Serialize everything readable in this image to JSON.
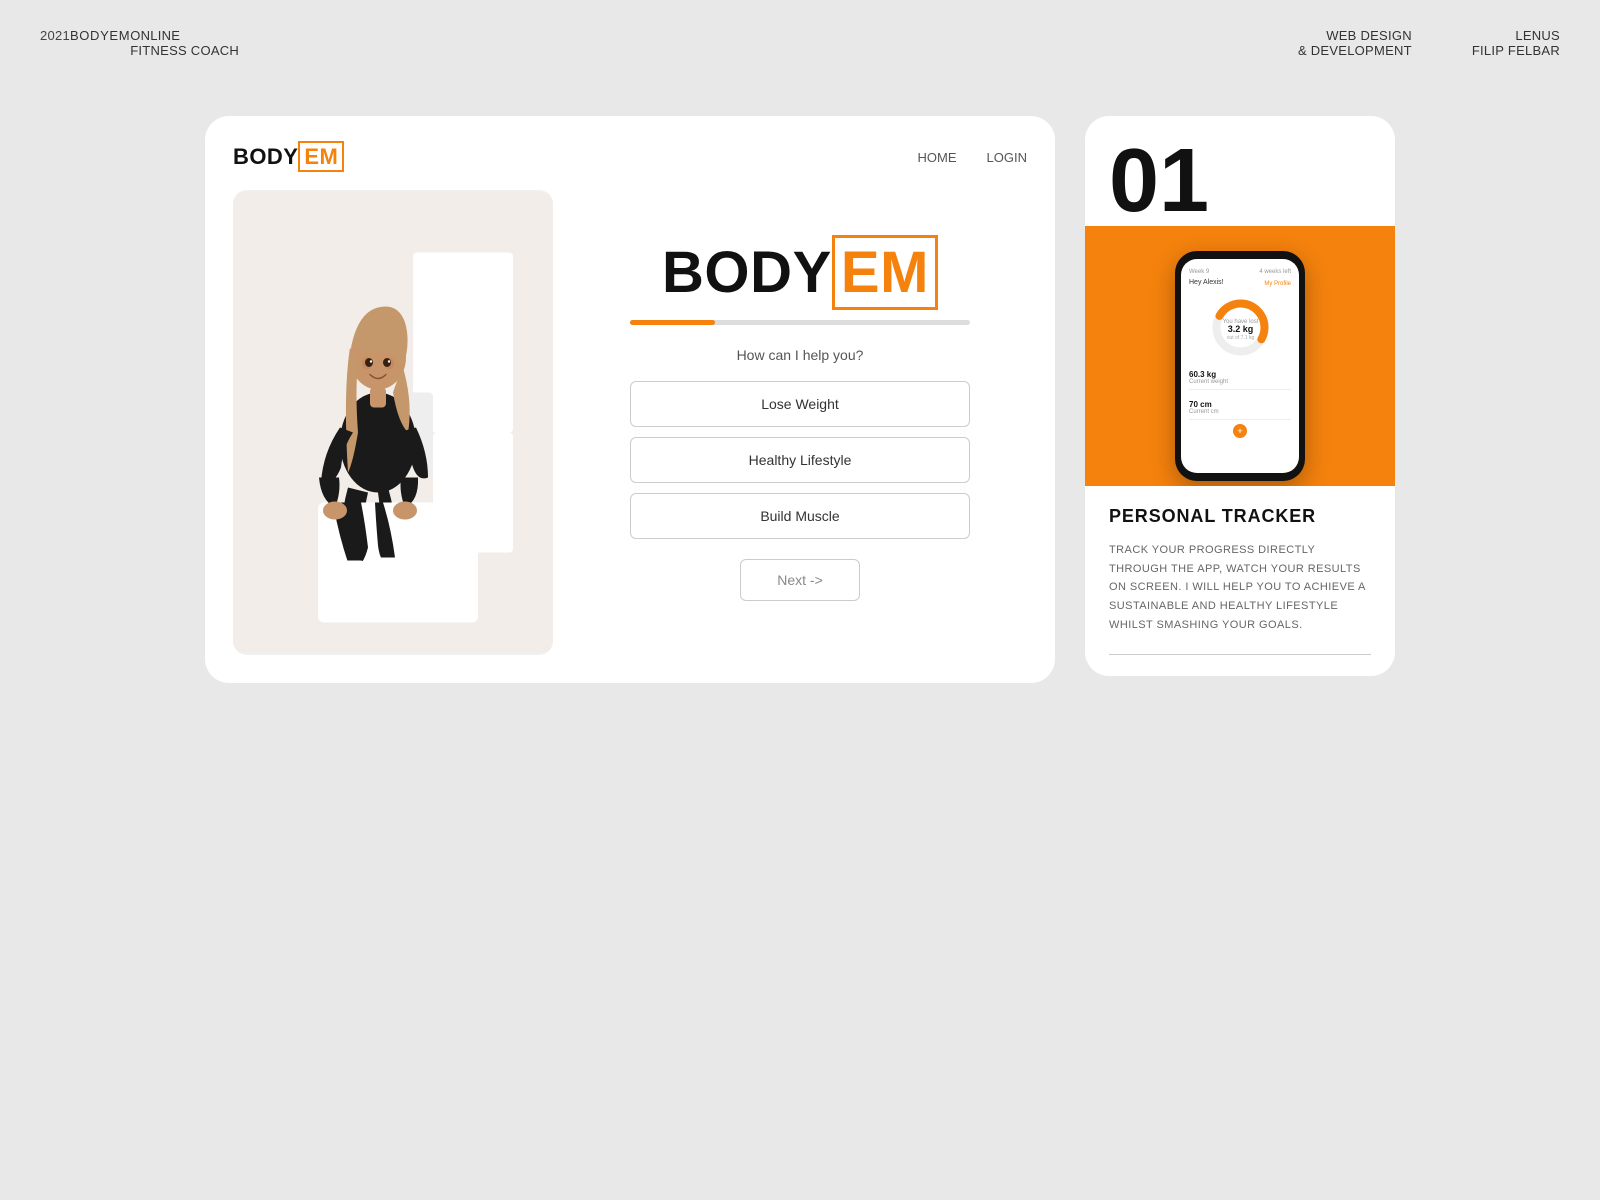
{
  "topnav": {
    "year": "2021",
    "brand": "BODYEM",
    "coach_line1": "ONLINE",
    "coach_line2": "FITNESS COACH",
    "webdesign_line1": "WEB DESIGN",
    "webdesign_line2": "& DEVELOPMENT",
    "author_line1": "LENUS",
    "author_line2": "FILIP FELBAR"
  },
  "left_card": {
    "logo_body": "BODY",
    "logo_em": "EM",
    "nav_home": "HOME",
    "nav_login": "LOGIN",
    "brand_large_body": "BODY",
    "brand_large_em": "EM",
    "question": "How can I help you?",
    "options": [
      {
        "label": "Lose Weight"
      },
      {
        "label": "Healthy Lifestyle"
      },
      {
        "label": "Build Muscle"
      }
    ],
    "next_button": "Next ->"
  },
  "right_card": {
    "number": "01",
    "phone": {
      "week_label": "Week 9",
      "weeks_left": "4 weeks left",
      "greeting": "Hey Alexis!",
      "my_profile": "My Profile",
      "lost_label": "You have lost",
      "lost_value": "3.2 kg",
      "lost_sub": "out of 7.1 kg",
      "weight_value": "60.3 kg",
      "weight_label": "Current weight",
      "cm_value": "70 cm",
      "cm_label": "Current cm"
    },
    "title": "PERSONAL TRACKER",
    "description": "TRACK YOUR PROGRESS DIRECTLY THROUGH THE APP, WATCH YOUR RESULTS ON SCREEN. I WILL HELP YOU TO ACHIEVE A SUSTAINABLE AND HEALTHY LIFESTYLE WHILST SMASHING YOUR GOALS."
  }
}
